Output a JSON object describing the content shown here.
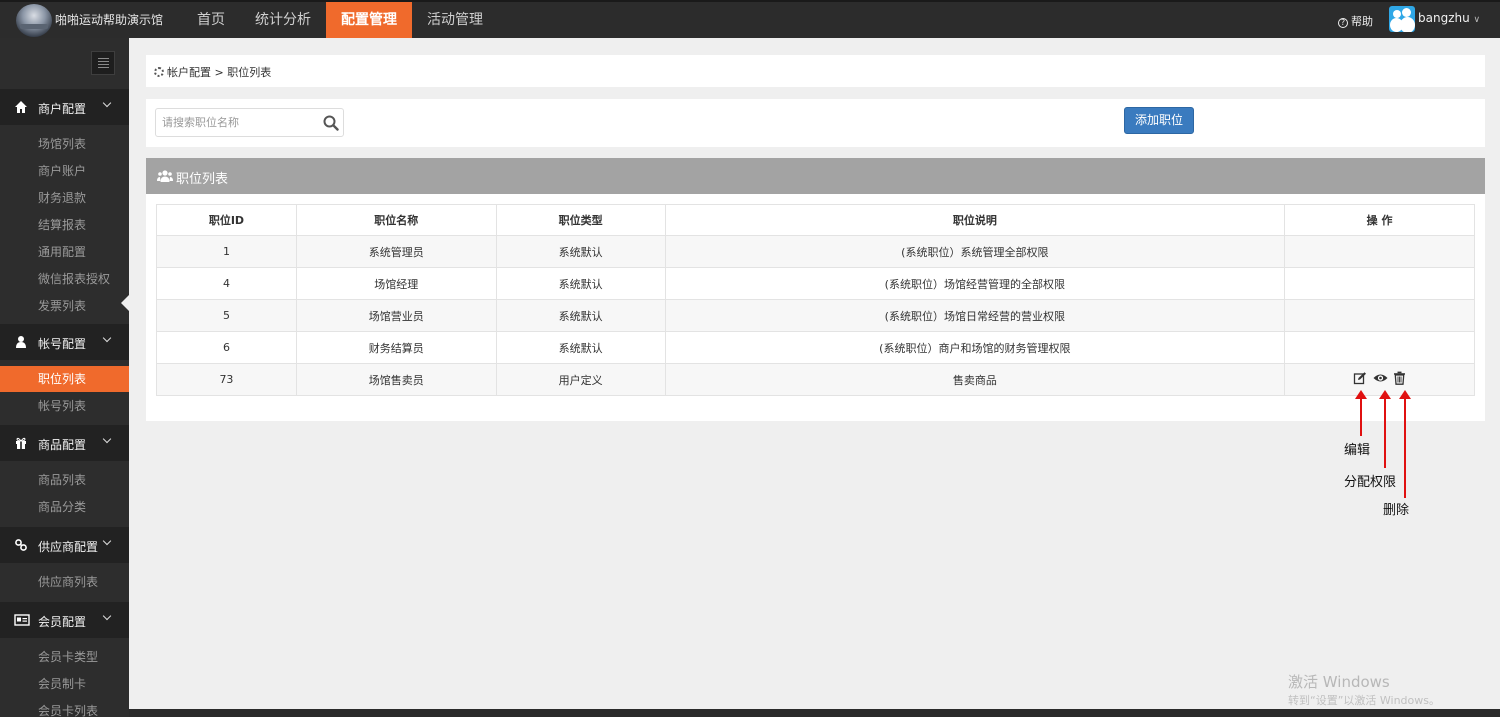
{
  "header": {
    "brand": "啪啪运动帮助演示馆",
    "nav": [
      "首页",
      "统计分析",
      "配置管理",
      "活动管理"
    ],
    "active_nav": "配置管理",
    "help": "帮助",
    "user": "bangzhu"
  },
  "sidebar": {
    "groups": [
      {
        "label": "商户配置",
        "items": [
          "场馆列表",
          "商户账户",
          "财务退款",
          "结算报表",
          "通用配置",
          "微信报表授权",
          "发票列表"
        ]
      },
      {
        "label": "帐号配置",
        "items": [
          "职位列表",
          "帐号列表"
        ]
      },
      {
        "label": "商品配置",
        "items": [
          "商品列表",
          "商品分类"
        ]
      },
      {
        "label": "供应商配置",
        "items": [
          "供应商列表"
        ]
      },
      {
        "label": "会员配置",
        "items": [
          "会员卡类型",
          "会员制卡",
          "会员卡列表"
        ]
      }
    ],
    "active_item": "职位列表"
  },
  "breadcrumb": {
    "parent": "帐户配置",
    "sep": ">",
    "current": "职位列表"
  },
  "search": {
    "placeholder": "请搜索职位名称",
    "value": ""
  },
  "add_button": "添加职位",
  "list": {
    "title": "职位列表",
    "columns": [
      "职位ID",
      "职位名称",
      "职位类型",
      "职位说明",
      "操 作"
    ],
    "rows": [
      {
        "id": "1",
        "name": "系统管理员",
        "type": "系统默认",
        "desc": "(系统职位）系统管理全部权限"
      },
      {
        "id": "4",
        "name": "场馆经理",
        "type": "系统默认",
        "desc": "(系统职位）场馆经营管理的全部权限"
      },
      {
        "id": "5",
        "name": "场馆营业员",
        "type": "系统默认",
        "desc": "(系统职位）场馆日常经营的营业权限"
      },
      {
        "id": "6",
        "name": "财务结算员",
        "type": "系统默认",
        "desc": "(系统职位）商户和场馆的财务管理权限"
      },
      {
        "id": "73",
        "name": "场馆售卖员",
        "type": "用户定义",
        "desc": "售卖商品"
      }
    ]
  },
  "annotations": {
    "edit": "编辑",
    "permission": "分配权限",
    "delete": "删除"
  },
  "watermark": {
    "line1": "激活 Windows",
    "line2": "转到“设置”以激活 Windows。"
  },
  "colors": {
    "accent": "#f06a2c",
    "primary_button": "#3a7bbf",
    "annotation": "#e01010"
  }
}
